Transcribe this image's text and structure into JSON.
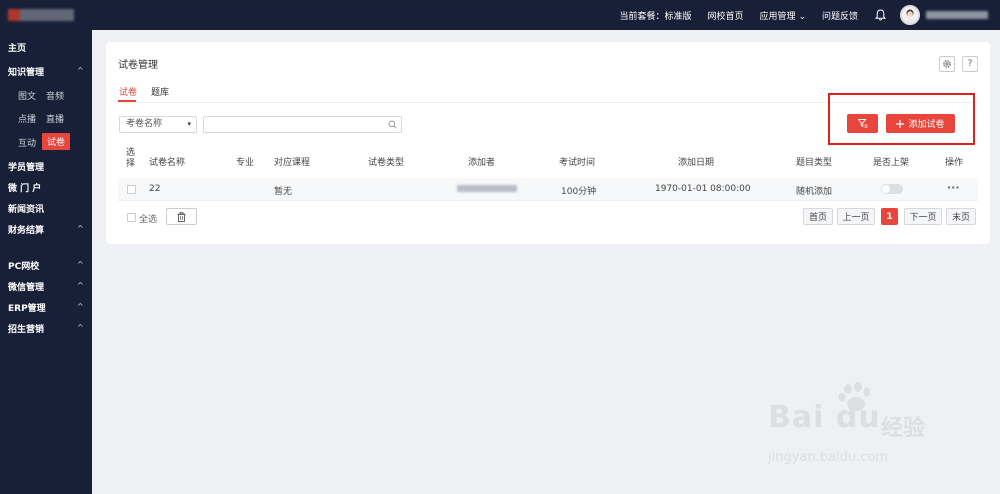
{
  "topbar": {
    "plan_label": "当前套餐：标准版",
    "school_home": "网校首页",
    "app_manage": "应用管理",
    "app_manage_caret": "⌄",
    "feedback": "问题反馈"
  },
  "sidebar": {
    "home": "主页",
    "knowledge": "知识管理",
    "knowledge_arrow": "^",
    "sub_graphic": "图文",
    "sub_audio": "音频",
    "sub_vod": "点播",
    "sub_live": "直播",
    "sub_interact": "互动",
    "sub_exam": "试卷",
    "students": "学员管理",
    "portal": "微 门 户",
    "news": "新闻资讯",
    "finance": "财务结算",
    "finance_arrow": "^",
    "pc_school": "PC网校",
    "pc_arrow": "^",
    "wechat": "微信管理",
    "wechat_arrow": "^",
    "erp": "ERP管理",
    "erp_arrow": "^",
    "marketing": "招生营销",
    "marketing_arrow": "^"
  },
  "main": {
    "title": "试卷管理",
    "help": "?",
    "tabs": [
      "试卷",
      "题库"
    ],
    "filter_select": "考卷名称",
    "filter_caret": "▾",
    "search_value": "",
    "add_button": "添加试卷",
    "columns": [
      "选择",
      "试卷名称",
      "专业",
      "对应课程",
      "试卷类型",
      "添加者",
      "考试时间",
      "添加日期",
      "题目类型",
      "是否上架",
      "操作"
    ],
    "rows": [
      {
        "name": "22",
        "major": "",
        "course": "暂无",
        "type": "",
        "exam_time": "100分钟",
        "date": "1970-01-01 08:00:00",
        "question_type": "随机添加",
        "on_shelf": false,
        "actions": "···"
      }
    ],
    "select_all": "全选",
    "pager": {
      "first": "首页",
      "prev": "上一页",
      "current": "1",
      "next": "下一页",
      "last": "末页"
    }
  },
  "watermark": {
    "brand": "Bai du",
    "cn": "经验",
    "url": "jingyan.baidu.com"
  },
  "colors": {
    "nav_bg": "#182038",
    "accent": "#e8453c",
    "highlight_border": "#e0201f",
    "page_bg": "#eef0f4"
  }
}
